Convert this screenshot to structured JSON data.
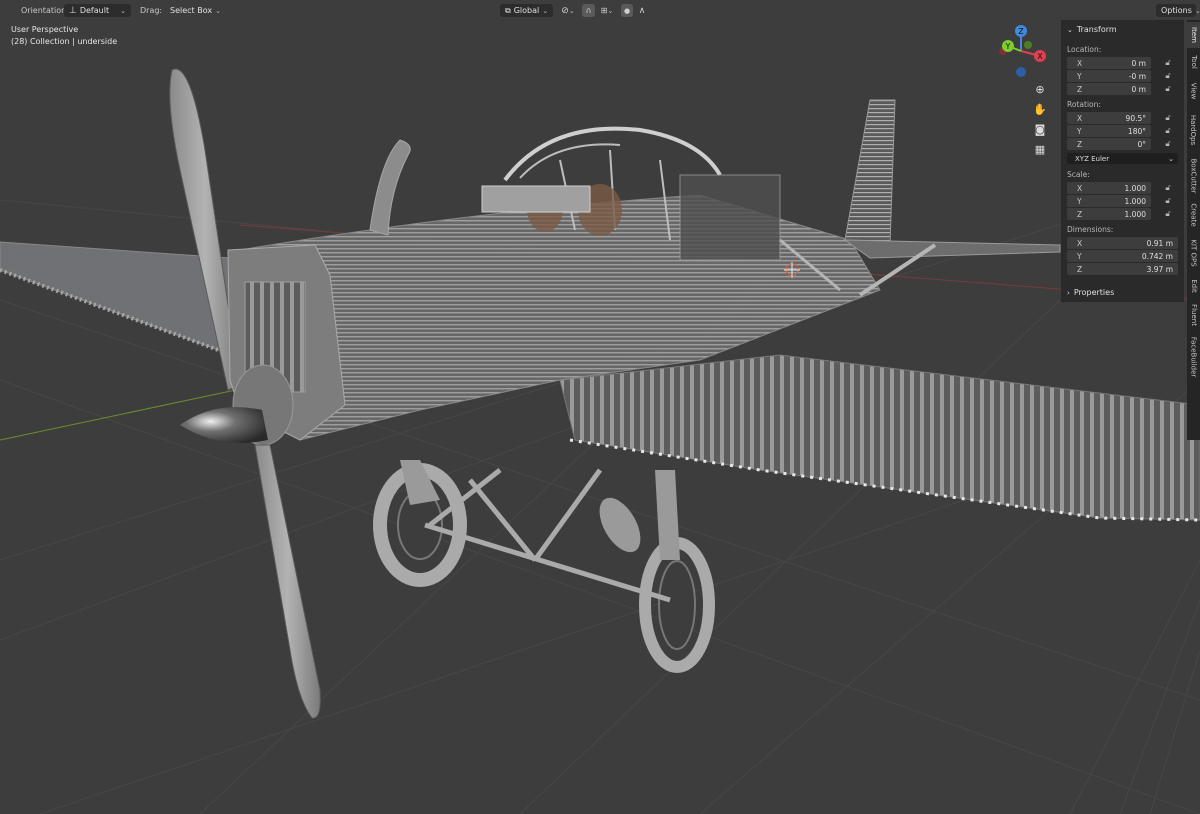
{
  "header": {
    "orientation_label": "Orientation:",
    "orientation_value": "Default",
    "drag_label": "Drag:",
    "drag_value": "Select Box",
    "transform_space": "Global",
    "options_label": "Options"
  },
  "overlay": {
    "view_name": "User Perspective",
    "collection_info": "(28) Collection | underside"
  },
  "gizmo": {
    "axis_x": "X",
    "axis_y": "Y",
    "axis_z": "Z"
  },
  "panel": {
    "transform_title": "Transform",
    "location_label": "Location:",
    "location": [
      {
        "axis": "X",
        "value": "0 m"
      },
      {
        "axis": "Y",
        "value": "-0 m"
      },
      {
        "axis": "Z",
        "value": "0 m"
      }
    ],
    "rotation_label": "Rotation:",
    "rotation": [
      {
        "axis": "X",
        "value": "90.5°"
      },
      {
        "axis": "Y",
        "value": "180°"
      },
      {
        "axis": "Z",
        "value": "0°"
      }
    ],
    "rotation_mode": "XYZ Euler",
    "scale_label": "Scale:",
    "scale": [
      {
        "axis": "X",
        "value": "1.000"
      },
      {
        "axis": "Y",
        "value": "1.000"
      },
      {
        "axis": "Z",
        "value": "1.000"
      }
    ],
    "dimensions_label": "Dimensions:",
    "dimensions": [
      {
        "axis": "X",
        "value": "0.91 m"
      },
      {
        "axis": "Y",
        "value": "0.742 m"
      },
      {
        "axis": "Z",
        "value": "3.97 m"
      }
    ],
    "properties_title": "Properties"
  },
  "tabs": [
    "Item",
    "Tool",
    "View",
    "HardOps",
    "BoxCutter",
    "Create",
    "KIT OPS",
    "Edit",
    "Fluent",
    "FaceBuilder"
  ],
  "colors": {
    "viewport_bg": "#3d3d3d",
    "panel_bg": "#2a2a2a",
    "field_bg": "#3e3e3e",
    "axis_x": "#e04050",
    "axis_y": "#7ccf2c",
    "axis_z": "#3f8ae0"
  }
}
